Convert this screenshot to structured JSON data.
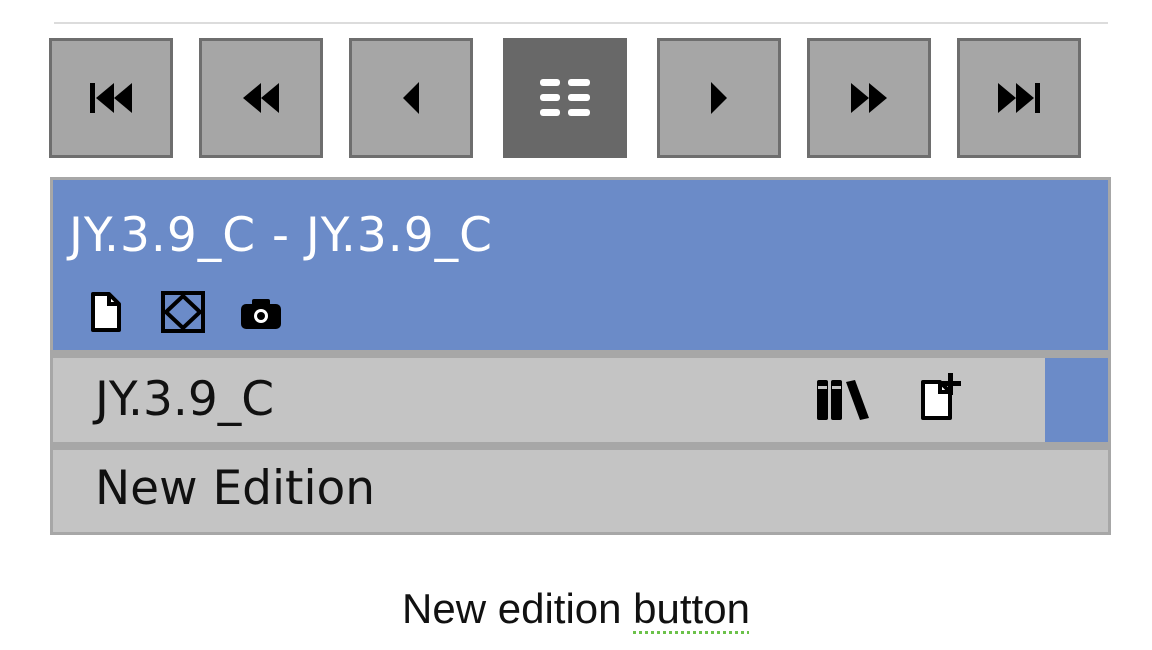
{
  "navigation": {
    "buttons": [
      {
        "icon": "first-page-icon"
      },
      {
        "icon": "previous-page-icon"
      },
      {
        "icon": "step-back-icon"
      },
      {
        "icon": "list-view-icon",
        "active": true
      },
      {
        "icon": "step-forward-icon"
      },
      {
        "icon": "next-page-icon"
      },
      {
        "icon": "last-page-icon"
      }
    ]
  },
  "header": {
    "title": "JY.3.9_C - JY.3.9_C",
    "icons": [
      "document-icon",
      "diamond-frame-icon",
      "camera-icon"
    ]
  },
  "edition_row": {
    "label": "JY.3.9_C",
    "icons": [
      "library-icon",
      "add-document-icon"
    ]
  },
  "new_edition_row": {
    "label": "New Edition"
  },
  "caption": {
    "text_before": "New edition ",
    "text_flagged": "button"
  },
  "colors": {
    "header": "#6b8bc8",
    "row": "#c4c4c4",
    "nav_button": "#a6a6a6",
    "nav_button_active": "#686868",
    "spellcheck_underline": "#6cc24a"
  }
}
